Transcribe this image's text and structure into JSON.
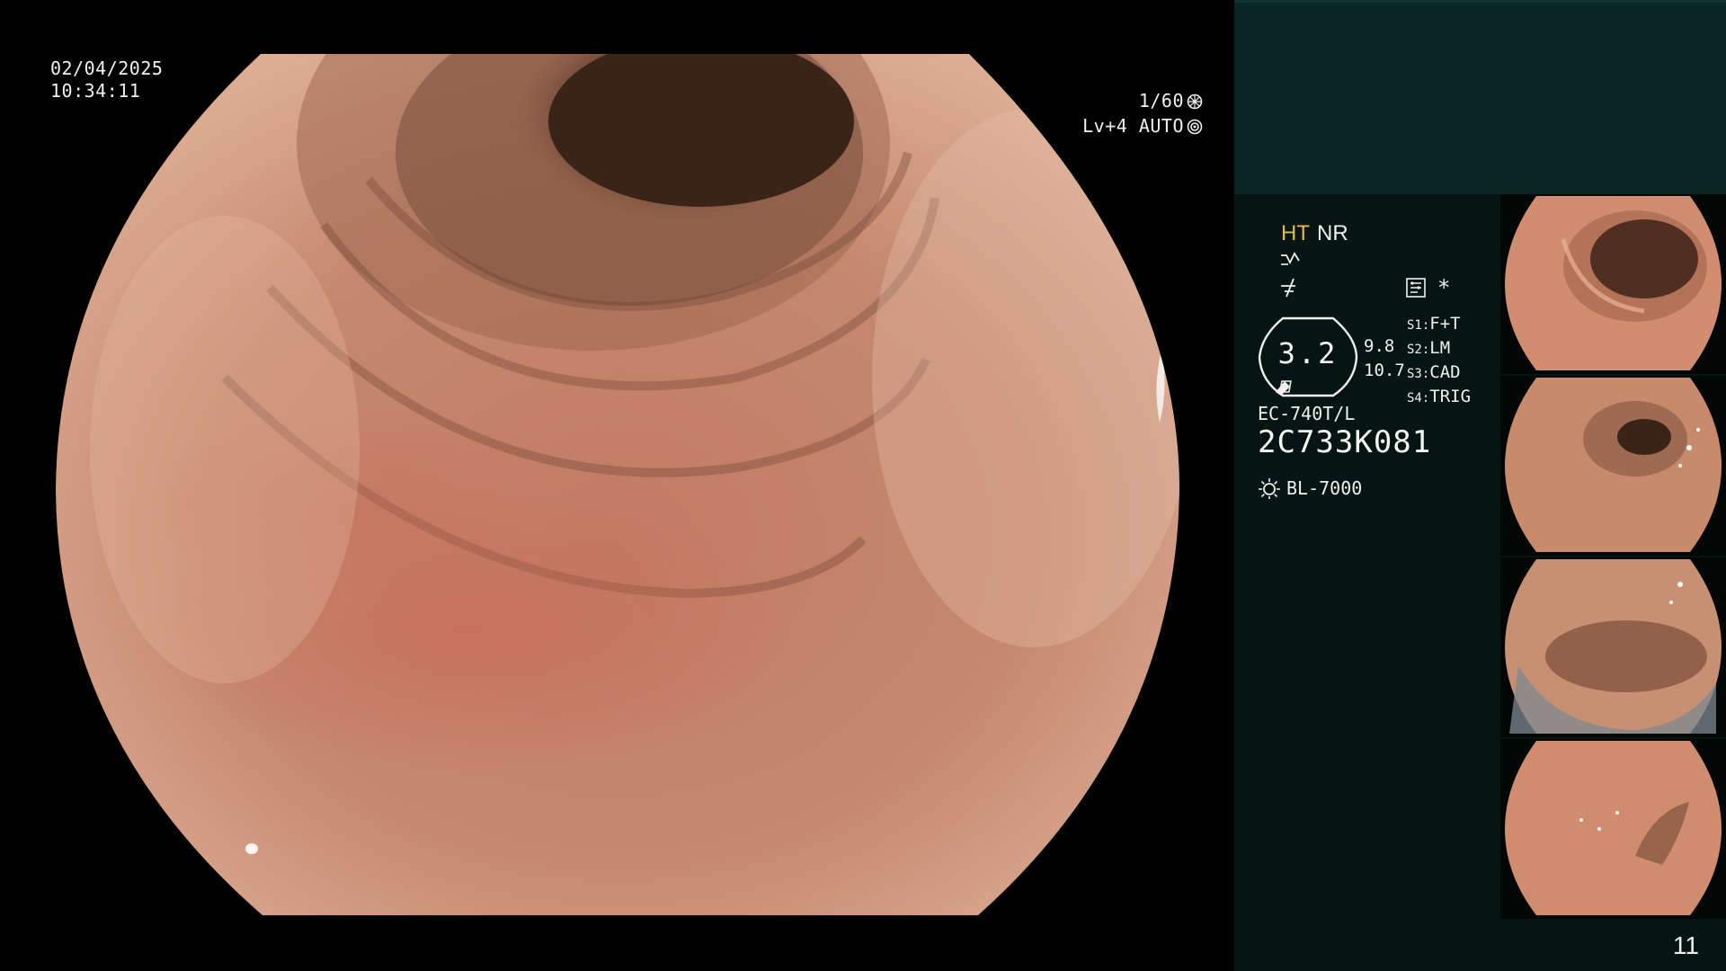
{
  "overlay": {
    "date": "02/04/2025",
    "time": "10:34:11",
    "shutter": "1/60",
    "shutter_icon": "shutter-icon",
    "light_level": "Lv+4 AUTO",
    "iris_icon": "iris-icon"
  },
  "panel": {
    "mode_ht": "HT",
    "mode_nr": "NR",
    "enhance_icon": "enhance-curve-icon",
    "structure_icon": "structure-enhance-icon",
    "memo_icon": "memo-icon",
    "star": "*",
    "gauge_value": "3.2",
    "gauge_ticks": [
      "9.8",
      "10.7"
    ],
    "switches": [
      {
        "key": "S1:",
        "value": "F+T"
      },
      {
        "key": "S2:",
        "value": "LM"
      },
      {
        "key": "S3:",
        "value": "CAD"
      },
      {
        "key": "S4:",
        "value": "TRIG"
      }
    ],
    "scope_model": "EC-740T/L",
    "scope_serial": "2C733K081",
    "light_source": "BL-7000",
    "light_icon": "light-source-icon",
    "page_number": "11"
  },
  "colors": {
    "mucosa": "#c98a6e",
    "lumen": "#3a2418",
    "panel_bg": "#061412",
    "panel_top": "#0a2624",
    "ht_accent": "#e6b84a"
  },
  "thumbnails": [
    "captured-image-1",
    "captured-image-2",
    "captured-image-3",
    "captured-image-4"
  ]
}
